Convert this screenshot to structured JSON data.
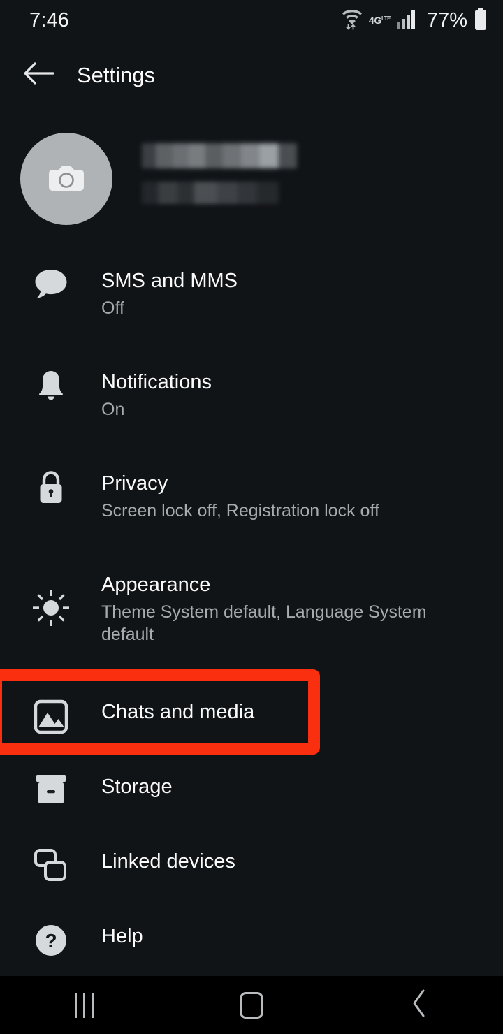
{
  "status_bar": {
    "time": "7:46",
    "battery_percent": "77%",
    "network_label": "4G",
    "network_sup": "LTE",
    "icons": [
      "wifi-data-icon",
      "network-4g-lte-icon",
      "signal-bars-icon",
      "battery-icon"
    ]
  },
  "app_bar": {
    "back_icon": "arrow-left-icon",
    "title": "Settings"
  },
  "profile": {
    "avatar_icon": "camera-icon",
    "name_redacted": true,
    "phone_redacted": true
  },
  "settings": {
    "items": [
      {
        "key": "sms-and-mms",
        "icon": "chat-bubble-icon",
        "title": "SMS and MMS",
        "subtitle": "Off"
      },
      {
        "key": "notifications",
        "icon": "bell-icon",
        "title": "Notifications",
        "subtitle": "On"
      },
      {
        "key": "privacy",
        "icon": "lock-icon",
        "title": "Privacy",
        "subtitle": "Screen lock off, Registration lock off"
      },
      {
        "key": "appearance",
        "icon": "sun-icon",
        "title": "Appearance",
        "subtitle": "Theme System default, Language System default"
      },
      {
        "key": "chats-and-media",
        "icon": "image-icon",
        "title": "Chats and media",
        "subtitle": ""
      },
      {
        "key": "storage",
        "icon": "archive-box-icon",
        "title": "Storage",
        "subtitle": ""
      },
      {
        "key": "linked-devices",
        "icon": "linked-devices-icon",
        "title": "Linked devices",
        "subtitle": ""
      },
      {
        "key": "help",
        "icon": "question-circle-icon",
        "title": "Help",
        "subtitle": ""
      }
    ]
  },
  "highlight": {
    "target": "chats-and-media",
    "color": "#fa2f10"
  },
  "nav_bar": {
    "recents_icon": "recents-icon",
    "home_icon": "home-icon",
    "back_icon": "back-chevron-icon"
  },
  "colors": {
    "background": "#111417",
    "text_primary": "#fafafa",
    "text_secondary": "#a7abae",
    "icon": "#d6d9db",
    "nav_background": "#000000",
    "highlight": "#fa2f10"
  }
}
